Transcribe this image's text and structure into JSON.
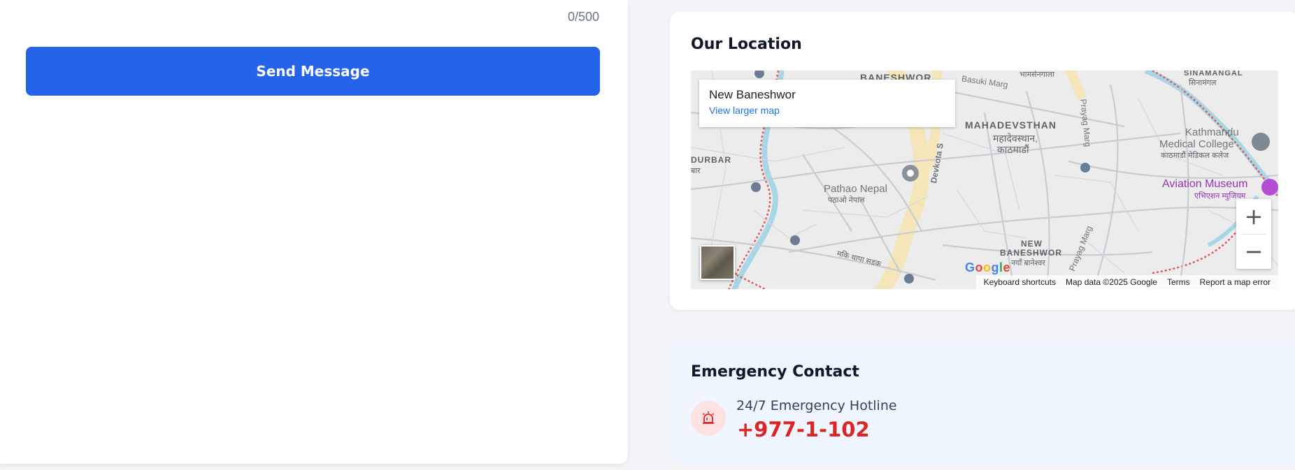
{
  "form": {
    "char_count": "0/500",
    "send_label": "Send Message"
  },
  "location": {
    "title": "Our Location",
    "map": {
      "place_name": "New Baneshwor",
      "larger_map_link": "View larger map",
      "zoom_in": "+",
      "zoom_out": "−",
      "google_logo": "Google",
      "attribution": {
        "shortcuts": "Keyboard shortcuts",
        "map_data": "Map data ©2025 Google",
        "terms": "Terms",
        "report": "Report a map error"
      },
      "labels": {
        "baneshwor": "BANESHWOR",
        "basuki": "Basuki Marg",
        "bhamsen": "भामसेनगाला",
        "sinamangal": "SINAMANGAL",
        "sinamangal_np": "सिनामंगल",
        "mahadevsthan": "MAHADEVSTHAN",
        "mahadevsthan_np1": "महादेवस्थान,",
        "mahadevsthan_np2": "काठमाडौं",
        "prayag": "Prayag Marg",
        "prayag2": "Prayag Marg",
        "kmc1": "Kathmandu",
        "kmc2": "Medical College",
        "kmc_np": "काठमाडौं मेडिकल कलेज",
        "durbar": "DURBAR",
        "durbar_np": "बार",
        "devkota": "Devkota S",
        "pathao": "Pathao Nepal",
        "pathao_np": "पठाओ नेपाल",
        "aviation": "Aviation Museum",
        "aviation_np": "एभिएशन म्युजियम",
        "new_baneshwor1": "NEW",
        "new_baneshwor2": "BANESHWOR",
        "new_baneshwor_np": "नयाँ बानेश्वर",
        "shanti": "मकि थापा सडक"
      }
    }
  },
  "emergency": {
    "title": "Emergency Contact",
    "hotline_label": "24/7 Emergency Hotline",
    "phone": "+977-1-102",
    "icon": "siren-icon"
  },
  "colors": {
    "primary": "#2563eb",
    "danger": "#dc2626",
    "emergency_bg": "#eff6ff"
  }
}
